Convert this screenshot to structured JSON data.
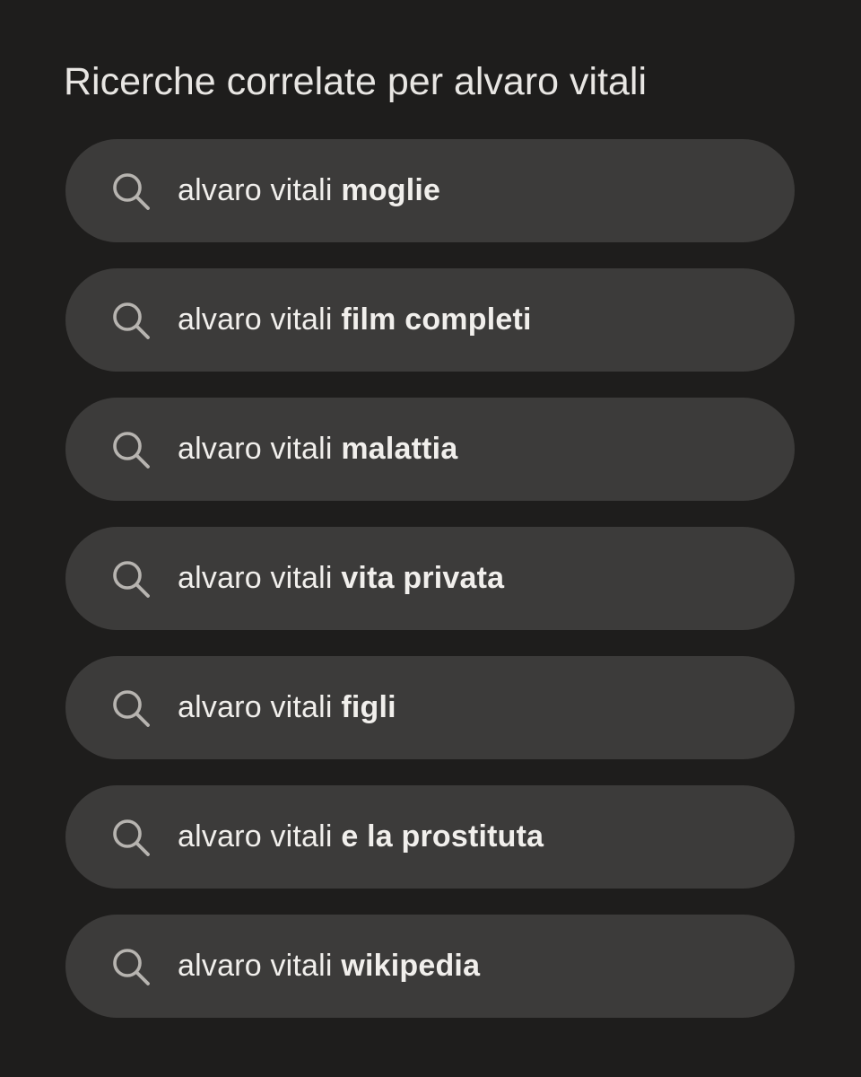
{
  "related": {
    "title": "Ricerche correlate per alvaro vitali",
    "icon": "search-icon",
    "suggestions": [
      {
        "prefix": "alvaro vitali",
        "suffix": "moglie"
      },
      {
        "prefix": "alvaro vitali",
        "suffix": "film completi"
      },
      {
        "prefix": "alvaro vitali",
        "suffix": "malattia"
      },
      {
        "prefix": "alvaro vitali",
        "suffix": "vita privata"
      },
      {
        "prefix": "alvaro vitali",
        "suffix": "figli"
      },
      {
        "prefix": "alvaro vitali",
        "suffix": "e la prostituta"
      },
      {
        "prefix": "alvaro vitali",
        "suffix": "wikipedia"
      }
    ]
  },
  "colors": {
    "background": "#1e1d1c",
    "pill": "#3c3b3a",
    "text": "#f1efec",
    "icon": "#b7b4b0"
  }
}
